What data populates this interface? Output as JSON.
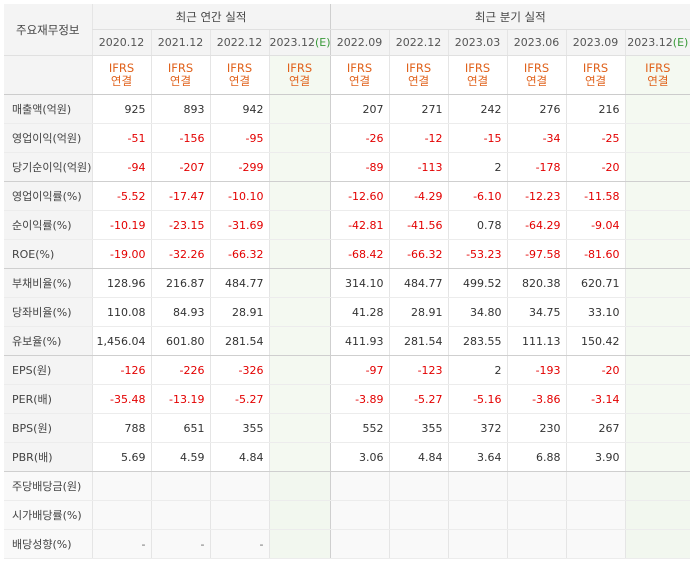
{
  "corner_label": "주요재무정보",
  "group_annual": "최근 연간 실적",
  "group_quarterly": "최근 분기 실적",
  "annual_periods": [
    "2020.12",
    "2021.12",
    "2022.12",
    "2023.12"
  ],
  "quarter_periods": [
    "2022.09",
    "2022.12",
    "2023.03",
    "2023.06",
    "2023.09",
    "2023.12"
  ],
  "estimate_mark": "(E)",
  "basis_line1": "IFRS",
  "basis_line2": "연결",
  "rows": [
    {
      "label": "매출액(억원)",
      "annual": [
        "925",
        "893",
        "942",
        ""
      ],
      "quarter": [
        "207",
        "271",
        "242",
        "276",
        "216",
        ""
      ]
    },
    {
      "label": "영업이익(억원)",
      "annual": [
        "-51",
        "-156",
        "-95",
        ""
      ],
      "quarter": [
        "-26",
        "-12",
        "-15",
        "-34",
        "-25",
        ""
      ]
    },
    {
      "label": "당기순이익(억원)",
      "annual": [
        "-94",
        "-207",
        "-299",
        ""
      ],
      "quarter": [
        "-89",
        "-113",
        "2",
        "-178",
        "-20",
        ""
      ]
    },
    {
      "label": "영업이익률(%)",
      "annual": [
        "-5.52",
        "-17.47",
        "-10.10",
        ""
      ],
      "quarter": [
        "-12.60",
        "-4.29",
        "-6.10",
        "-12.23",
        "-11.58",
        ""
      ]
    },
    {
      "label": "순이익률(%)",
      "annual": [
        "-10.19",
        "-23.15",
        "-31.69",
        ""
      ],
      "quarter": [
        "-42.81",
        "-41.56",
        "0.78",
        "-64.29",
        "-9.04",
        ""
      ]
    },
    {
      "label": "ROE(%)",
      "annual": [
        "-19.00",
        "-32.26",
        "-66.32",
        ""
      ],
      "quarter": [
        "-68.42",
        "-66.32",
        "-53.23",
        "-97.58",
        "-81.60",
        ""
      ]
    },
    {
      "label": "부채비율(%)",
      "annual": [
        "128.96",
        "216.87",
        "484.77",
        ""
      ],
      "quarter": [
        "314.10",
        "484.77",
        "499.52",
        "820.38",
        "620.71",
        ""
      ]
    },
    {
      "label": "당좌비율(%)",
      "annual": [
        "110.08",
        "84.93",
        "28.91",
        ""
      ],
      "quarter": [
        "41.28",
        "28.91",
        "34.80",
        "34.75",
        "33.10",
        ""
      ]
    },
    {
      "label": "유보율(%)",
      "annual": [
        "1,456.04",
        "601.80",
        "281.54",
        ""
      ],
      "quarter": [
        "411.93",
        "281.54",
        "283.55",
        "111.13",
        "150.42",
        ""
      ]
    },
    {
      "label": "EPS(원)",
      "annual": [
        "-126",
        "-226",
        "-326",
        ""
      ],
      "quarter": [
        "-97",
        "-123",
        "2",
        "-193",
        "-20",
        ""
      ]
    },
    {
      "label": "PER(배)",
      "annual": [
        "-35.48",
        "-13.19",
        "-5.27",
        ""
      ],
      "quarter": [
        "-3.89",
        "-5.27",
        "-5.16",
        "-3.86",
        "-3.14",
        ""
      ]
    },
    {
      "label": "BPS(원)",
      "annual": [
        "788",
        "651",
        "355",
        ""
      ],
      "quarter": [
        "552",
        "355",
        "372",
        "230",
        "267",
        ""
      ]
    },
    {
      "label": "PBR(배)",
      "annual": [
        "5.69",
        "4.59",
        "4.84",
        ""
      ],
      "quarter": [
        "3.06",
        "4.84",
        "3.64",
        "6.88",
        "3.90",
        ""
      ]
    },
    {
      "label": "주당배당금(원)",
      "annual": [
        "",
        "",
        "",
        ""
      ],
      "quarter": [
        "",
        "",
        "",
        "",
        "",
        ""
      ]
    },
    {
      "label": "시가배당률(%)",
      "annual": [
        "",
        "",
        "",
        ""
      ],
      "quarter": [
        "",
        "",
        "",
        "",
        "",
        ""
      ]
    },
    {
      "label": "배당성향(%)",
      "annual": [
        "-",
        "-",
        "-",
        ""
      ],
      "quarter": [
        "",
        "",
        "",
        "",
        "",
        ""
      ]
    }
  ],
  "colors": {
    "negative": "#e30000",
    "basis": "#e0621c",
    "estimate_mark": "#3a9a3a",
    "estimate_bg": "#f4f9f1",
    "header_bg": "#f4f4f4"
  }
}
